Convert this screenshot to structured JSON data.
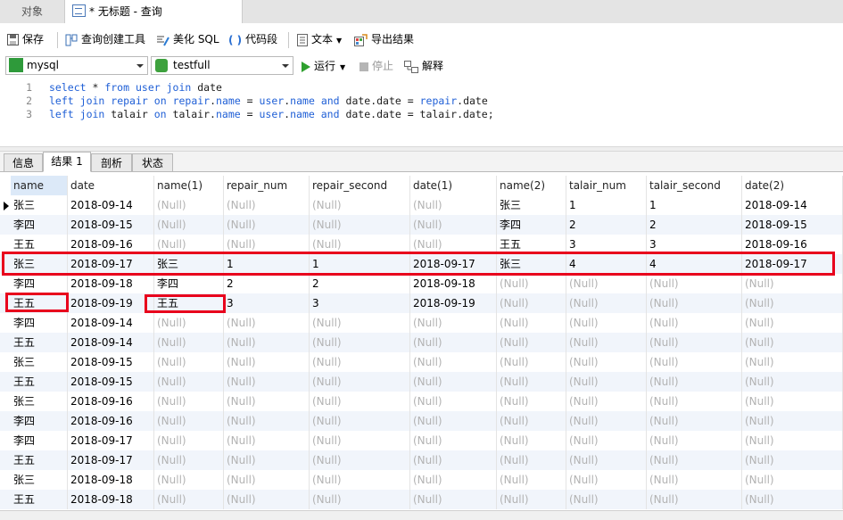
{
  "tabs": {
    "objects": "对象",
    "query": "* 无标题 - 查询"
  },
  "toolbar": {
    "save": "保存",
    "query_builder": "查询创建工具",
    "beautify": "美化 SQL",
    "snippet": "代码段",
    "text": "文本",
    "export": "导出结果"
  },
  "connection": {
    "connection": "mysql",
    "database": "testfull",
    "run": "运行",
    "stop": "停止",
    "explain": "解释"
  },
  "editor": {
    "line_numbers": [
      "1",
      "2",
      "3"
    ]
  },
  "result_tabs": [
    "信息",
    "结果 1",
    "剖析",
    "状态"
  ],
  "columns": [
    "name",
    "date",
    "name(1)",
    "repair_num",
    "repair_second",
    "date(1)",
    "name(2)",
    "talair_num",
    "talair_second",
    "date(2)"
  ],
  "rows": [
    [
      "张三",
      "2018-09-14",
      "(Null)",
      "(Null)",
      "(Null)",
      "(Null)",
      "张三",
      "1",
      "1",
      "2018-09-14"
    ],
    [
      "李四",
      "2018-09-15",
      "(Null)",
      "(Null)",
      "(Null)",
      "(Null)",
      "李四",
      "2",
      "2",
      "2018-09-15"
    ],
    [
      "王五",
      "2018-09-16",
      "(Null)",
      "(Null)",
      "(Null)",
      "(Null)",
      "王五",
      "3",
      "3",
      "2018-09-16"
    ],
    [
      "张三",
      "2018-09-17",
      "张三",
      "1",
      "1",
      "2018-09-17",
      "张三",
      "4",
      "4",
      "2018-09-17"
    ],
    [
      "李四",
      "2018-09-18",
      "李四",
      "2",
      "2",
      "2018-09-18",
      "(Null)",
      "(Null)",
      "(Null)",
      "(Null)"
    ],
    [
      "王五",
      "2018-09-19",
      "王五",
      "3",
      "3",
      "2018-09-19",
      "(Null)",
      "(Null)",
      "(Null)",
      "(Null)"
    ],
    [
      "李四",
      "2018-09-14",
      "(Null)",
      "(Null)",
      "(Null)",
      "(Null)",
      "(Null)",
      "(Null)",
      "(Null)",
      "(Null)"
    ],
    [
      "王五",
      "2018-09-14",
      "(Null)",
      "(Null)",
      "(Null)",
      "(Null)",
      "(Null)",
      "(Null)",
      "(Null)",
      "(Null)"
    ],
    [
      "张三",
      "2018-09-15",
      "(Null)",
      "(Null)",
      "(Null)",
      "(Null)",
      "(Null)",
      "(Null)",
      "(Null)",
      "(Null)"
    ],
    [
      "王五",
      "2018-09-15",
      "(Null)",
      "(Null)",
      "(Null)",
      "(Null)",
      "(Null)",
      "(Null)",
      "(Null)",
      "(Null)"
    ],
    [
      "张三",
      "2018-09-16",
      "(Null)",
      "(Null)",
      "(Null)",
      "(Null)",
      "(Null)",
      "(Null)",
      "(Null)",
      "(Null)"
    ],
    [
      "李四",
      "2018-09-16",
      "(Null)",
      "(Null)",
      "(Null)",
      "(Null)",
      "(Null)",
      "(Null)",
      "(Null)",
      "(Null)"
    ],
    [
      "李四",
      "2018-09-17",
      "(Null)",
      "(Null)",
      "(Null)",
      "(Null)",
      "(Null)",
      "(Null)",
      "(Null)",
      "(Null)"
    ],
    [
      "王五",
      "2018-09-17",
      "(Null)",
      "(Null)",
      "(Null)",
      "(Null)",
      "(Null)",
      "(Null)",
      "(Null)",
      "(Null)"
    ],
    [
      "张三",
      "2018-09-18",
      "(Null)",
      "(Null)",
      "(Null)",
      "(Null)",
      "(Null)",
      "(Null)",
      "(Null)",
      "(Null)"
    ],
    [
      "王五",
      "2018-09-18",
      "(Null)",
      "(Null)",
      "(Null)",
      "(Null)",
      "(Null)",
      "(Null)",
      "(Null)",
      "(Null)"
    ]
  ],
  "colors": {
    "highlight": "#e8001c",
    "keyword": "#1f5fd6",
    "null_text": "#b3b3b3"
  }
}
